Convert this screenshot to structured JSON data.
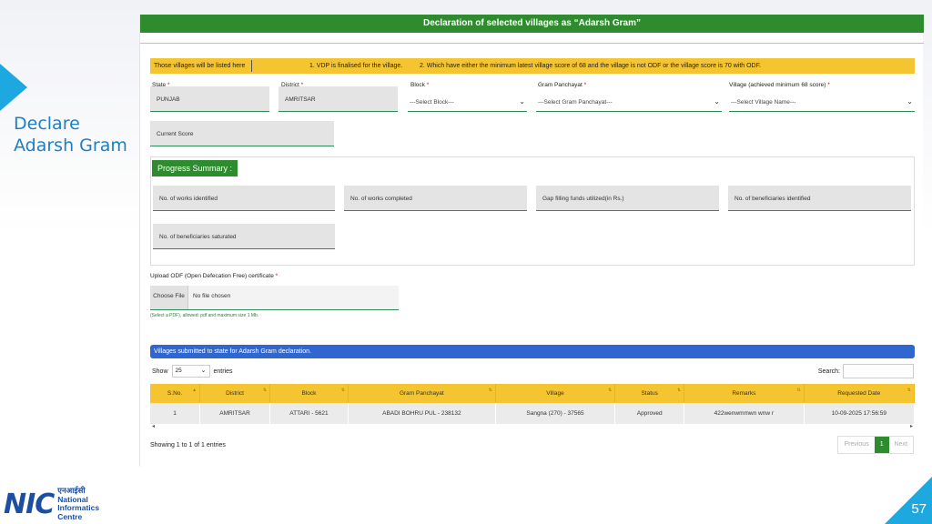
{
  "slide": {
    "title": "Declare Adarsh Gram",
    "page_number": "57",
    "logo": {
      "mark": "NIC",
      "hindi": "एनआईसी",
      "line1": "National",
      "line2": "Informatics",
      "line3": "Centre"
    }
  },
  "form": {
    "header": "Declaration of selected villages as “Adarsh Gram”",
    "info": {
      "label": "Those villages will be listed here",
      "point1": "1. VDP is finalised for the village.",
      "point2": "2. Which have either the minimum latest village score of 68 and the village is not ODF or the village score is 70 with ODF."
    },
    "fields": {
      "state": {
        "label": "State",
        "value": "PUNJAB"
      },
      "district": {
        "label": "District",
        "value": "AMRITSAR"
      },
      "block": {
        "label": "Block",
        "value": "---Select Block---"
      },
      "gram_panchayat": {
        "label": "Gram Panchayat",
        "value": "---Select Gram Panchayat---"
      },
      "village": {
        "label": "Village (achieved minimum 68 score)",
        "value": "---Select Village Name---"
      },
      "current_score": {
        "placeholder": "Current Score"
      }
    },
    "progress": {
      "title": "Progress Summary :",
      "works_identified": "No. of works identified",
      "works_completed": "No. of works completed",
      "gap_funds": "Gap filling funds utilized(in Rs.)",
      "beneficiaries_identified": "No. of beneficiaries identified",
      "beneficiaries_saturated": "No. of beneficiaries saturated"
    },
    "upload": {
      "label": "Upload ODF (Open Defecation Free) certificate",
      "button": "Choose File",
      "status": "No file chosen",
      "hint": "(Select a PDF), allowed: pdf and maximum size 1 Mb."
    }
  },
  "villages": {
    "title": "Villages submitted to state for Adarsh Gram declaration.",
    "show_label": "Show",
    "show_value": "25",
    "entries_label": "entries",
    "search_label": "Search:",
    "columns": [
      "S.No.",
      "District",
      "Block",
      "Gram Panchayat",
      "Village",
      "Status",
      "Remarks",
      "Requested Date"
    ],
    "rows": [
      [
        "1",
        "AMRITSAR",
        "ATTARI - 5621",
        "ABADI BOHRU PUL - 238132",
        "Sangna (270) - 37565",
        "Approved",
        "422wenwmmwn wnw r",
        "10-09-2025 17:56:59"
      ]
    ],
    "showing": "Showing 1 to 1 of 1 entries",
    "pager": {
      "previous": "Previous",
      "page": "1",
      "next": "Next"
    }
  },
  "colors": {
    "header_green": "#2e8b2e",
    "info_yellow": "#f4c531",
    "villages_blue": "#2f66cf",
    "accent_cyan": "#1da9e0"
  }
}
